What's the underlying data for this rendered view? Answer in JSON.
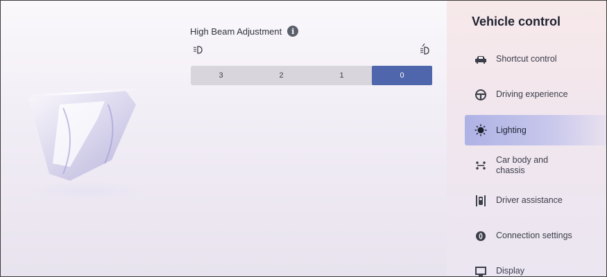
{
  "high_beam": {
    "title": "High Beam Adjustment",
    "info_glyph": "i",
    "levels": [
      "3",
      "2",
      "1",
      "0"
    ],
    "selected_level": "0"
  },
  "sidebar": {
    "title": "Vehicle control",
    "items": [
      {
        "label": "Shortcut control",
        "icon": "car-icon"
      },
      {
        "label": "Driving experience",
        "icon": "steering-wheel-icon"
      },
      {
        "label": "Lighting",
        "icon": "light-bulb-icon",
        "active": true
      },
      {
        "label": "Car body and chassis",
        "icon": "chassis-icon"
      },
      {
        "label": "Driver assistance",
        "icon": "driver-assist-icon"
      },
      {
        "label": "Connection settings",
        "icon": "connection-icon"
      },
      {
        "label": "Display",
        "icon": "display-icon"
      }
    ]
  },
  "colors": {
    "accent": "#4f66ad",
    "active_menu": "#b4b6e6",
    "segment_bg": "#d9d5dc"
  }
}
